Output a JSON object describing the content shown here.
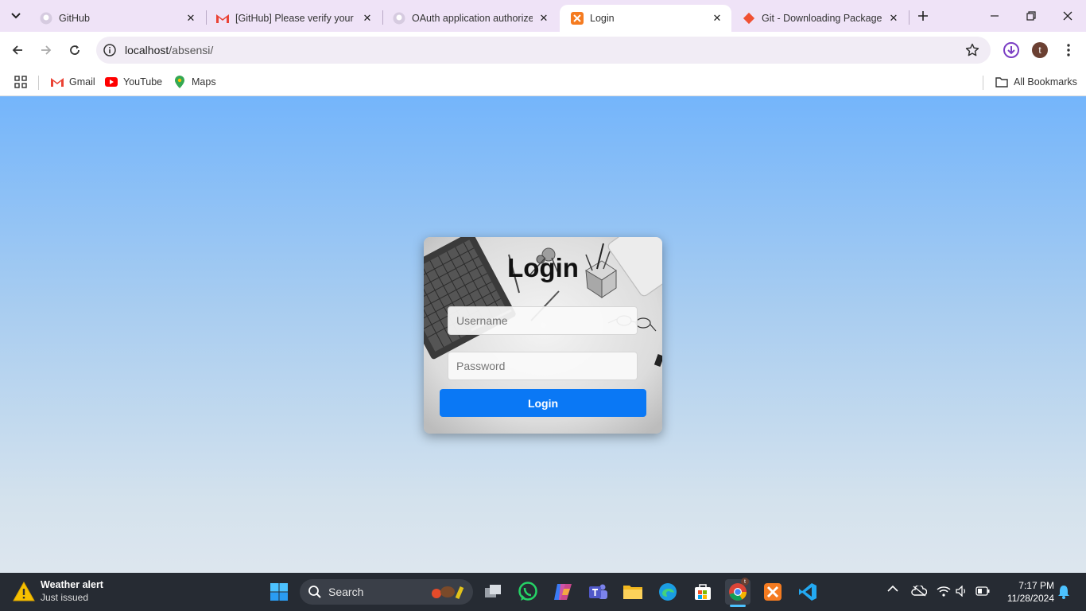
{
  "tabs": [
    {
      "title": "GitHub",
      "close": "✕"
    },
    {
      "title": "[GitHub] Please verify your d",
      "close": "✕"
    },
    {
      "title": "OAuth application authorize",
      "close": "✕"
    },
    {
      "title": "Login",
      "close": "✕"
    },
    {
      "title": "Git - Downloading Package",
      "close": "✕"
    }
  ],
  "address": {
    "url_host": "localhost",
    "url_path": "/absensi/"
  },
  "profile_initial": "t",
  "bookmarks": {
    "items": [
      {
        "label": "Gmail",
        "icon": "gmail-icon"
      },
      {
        "label": "YouTube",
        "icon": "youtube-icon"
      },
      {
        "label": "Maps",
        "icon": "maps-icon"
      }
    ],
    "all": "All Bookmarks"
  },
  "login": {
    "heading": "Login",
    "username_placeholder": "Username",
    "password_placeholder": "Password",
    "button": "Login",
    "button_color": "#0a78f5"
  },
  "taskbar": {
    "weather_title": "Weather alert",
    "weather_sub": "Just issued",
    "search_label": "Search",
    "time": "7:17 PM",
    "date": "11/28/2024"
  },
  "colors": {
    "tabstrip": "#efe3f7",
    "page_top": "#74b5fb",
    "page_bottom": "#dde6ee",
    "taskbar": "#262b33"
  }
}
